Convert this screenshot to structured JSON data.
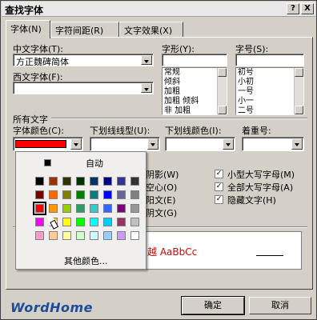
{
  "title": "查找字体",
  "title_buttons": {
    "help": "?",
    "close": "X"
  },
  "tabs": [
    {
      "label": "字体(N)"
    },
    {
      "label": "字符间距(R)"
    },
    {
      "label": "文字效果(X)"
    }
  ],
  "font_section": {
    "chinese_font_label": "中文字体(T):",
    "chinese_font_value": "方正魏碑简体",
    "western_font_label": "西文字体(F):",
    "western_font_value": "",
    "style_label": "字形(Y):",
    "style_value": "",
    "style_options": [
      "常规",
      "倾斜",
      "加粗",
      "加粗 倾斜",
      "非 加粗"
    ],
    "size_label": "字号(S):",
    "size_value": "",
    "size_options": [
      "初号",
      "小初",
      "一号",
      "小一",
      "二号"
    ]
  },
  "all_text": {
    "heading": "所有文字",
    "font_color_label": "字体颜色(C):",
    "font_color_value": "#ff0000",
    "underline_label": "下划线线型(U):",
    "underline_color_label": "下划线颜色(I):",
    "emphasis_label": "着重号:"
  },
  "effects": {
    "left_partial": [
      "阴影",
      "空心",
      "阳文",
      "阴文"
    ],
    "left_keys": [
      "(W)",
      "(O)",
      "(E)",
      "(G)"
    ],
    "right": [
      {
        "label": "小型大写字母(M)",
        "checked": true
      },
      {
        "label": "全部大写字母(A)",
        "checked": true
      },
      {
        "label": "隐藏文字(H)",
        "checked": true
      }
    ]
  },
  "color_popup": {
    "auto_label": "自动",
    "more_label": "其他颜色...",
    "colors": [
      [
        "#000000",
        "#993300",
        "#333300",
        "#003300",
        "#003366",
        "#000080",
        "#333399",
        "#333333"
      ],
      [
        "#800000",
        "#ff6600",
        "#808000",
        "#008000",
        "#008080",
        "#0000ff",
        "#666699",
        "#808080"
      ],
      [
        "#ff0000",
        "#ff9900",
        "#99cc00",
        "#339966",
        "#33cccc",
        "#3366ff",
        "#800080",
        "#969696"
      ],
      [
        "#ff00ff",
        "#ffcc00",
        "#ffff00",
        "#00ff00",
        "#00ffff",
        "#00ccff",
        "#993366",
        "#c0c0c0"
      ],
      [
        "#ff99cc",
        "#ffcc99",
        "#ffff99",
        "#ccffcc",
        "#ccffff",
        "#99ccff",
        "#cc99ff",
        "#ffffff"
      ]
    ],
    "selected": "#ff0000"
  },
  "preview": {
    "text": "越 AaBbCc",
    "text_color": "#d40000"
  },
  "buttons": {
    "ok": "确定",
    "cancel": "取消"
  },
  "watermark": "WordHome"
}
